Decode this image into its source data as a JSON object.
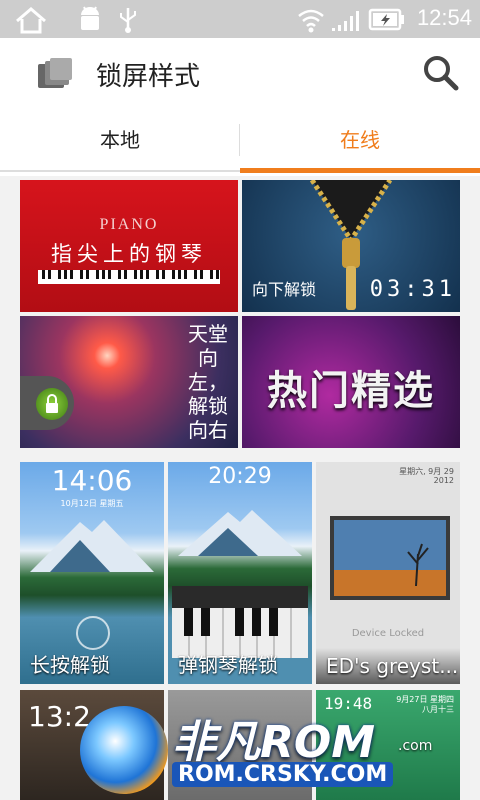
{
  "status": {
    "time": "12:54"
  },
  "appbar": {
    "title": "锁屏样式"
  },
  "tabs": [
    {
      "label": "本地"
    },
    {
      "label": "在线"
    }
  ],
  "featured": [
    {
      "title": "PIANO",
      "subtitle": "指尖上的钢琴"
    },
    {
      "caption": "向下解锁",
      "clock": "03:31"
    },
    {
      "vertical_text": "天堂向左，解锁向右"
    },
    {
      "title": "热门精选"
    }
  ],
  "themes": [
    {
      "label": "长按解锁",
      "clock": "14:06",
      "date": "10月12日 星期五"
    },
    {
      "label": "弹钢琴解锁",
      "clock": "20:29"
    },
    {
      "label": "ED's greyst...",
      "date": "星期六, 9月 29",
      "year": "2012",
      "device_text": "Device Locked"
    }
  ],
  "bottom_row": [
    {
      "clock": "13:2"
    },
    {
      "clock": "19:48",
      "date": "9月27日 星期四",
      "lunar": "八月十三"
    }
  ],
  "watermark": {
    "brand": "非凡ROM",
    "url": "ROM.CRSKY.COM",
    "suffix": ".com"
  },
  "colors": {
    "accent": "#f07d1c",
    "statusbar": "#cdcdcd"
  }
}
